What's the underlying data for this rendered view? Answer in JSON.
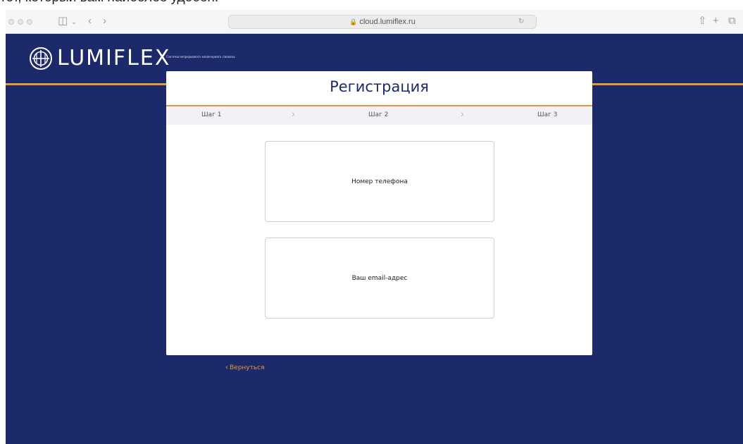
{
  "caption": "тот, который вам наиболее удобен.",
  "browser": {
    "url": "cloud.lumiflex.ru",
    "icons": [
      "sidebar-icon",
      "chevron-down-icon",
      "back-icon",
      "forward-icon",
      "share-icon",
      "new-tab-icon",
      "tabs-icon",
      "reload-icon",
      "lock-icon"
    ]
  },
  "header": {
    "logo_text": "LUMIFLEX",
    "logo_tagline": "Система непрерывного мониторинга глюкозы",
    "colors": {
      "background": "#1c2a6c",
      "accent": "#e39a33"
    }
  },
  "registration": {
    "title": "Регистрация",
    "steps": [
      {
        "label": "Шаг 1"
      },
      {
        "label": "Шаг 2"
      },
      {
        "label": "Шаг 3"
      }
    ],
    "options": [
      {
        "label": "Номер телефона"
      },
      {
        "label": "Ваш email-адрес"
      }
    ],
    "back_label": "Вернуться"
  }
}
